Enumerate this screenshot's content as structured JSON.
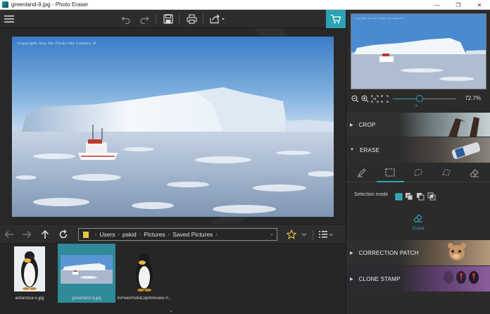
{
  "window": {
    "title": "greenland-9.jpg - Photo Eraser",
    "controls": [
      "—",
      "❐",
      "✕"
    ]
  },
  "canvas": {
    "watermark": "Copyright Aziz for Flickr the Camera ©"
  },
  "breadcrumb": {
    "segments": [
      "Users",
      "pskid",
      "Pictures",
      "Saved Pictures"
    ]
  },
  "filmstrip": {
    "items": [
      {
        "label": "antarctica-5.jpg",
        "selected": false
      },
      {
        "label": "greenland-9.jpg",
        "selected": true
      },
      {
        "label": "InPixioPhotoClip9Review-P...",
        "selected": false
      }
    ]
  },
  "preview": {
    "watermark": "Copyright Aziz for Flickr the Camera ©"
  },
  "zoom": {
    "value_text": "72.7%",
    "level": 0.42
  },
  "sections": {
    "crop": "CROP",
    "erase": "ERASE",
    "correction_patch": "CORRECTION PATCH",
    "clone_stamp": "CLONE STAMP"
  },
  "erase_panel": {
    "selection_mode_label": "Selection mode",
    "erase_button_label": "Erase"
  },
  "colors": {
    "accent": "#2ba3b3",
    "panel_bg": "#2b2b2b",
    "folder": "#e7c24a",
    "star": "#e7c24a"
  }
}
